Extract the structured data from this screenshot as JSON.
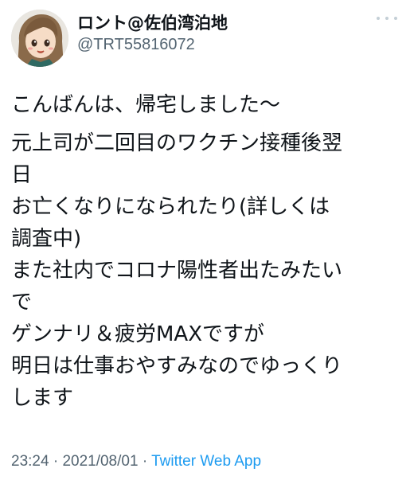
{
  "tweet": {
    "author": {
      "display_name": "ロント@佐伯湾泊地",
      "handle": "@TRT55816072",
      "avatar_icon": "anime-character-avatar-icon"
    },
    "more_icon": "more-options-icon",
    "paragraphs": [
      "こんばんは、帰宅しました〜",
      "元上司が二回目のワクチン接種後翌\n日\nお亡くなりになられたり(詳しくは\n調査中)\nまた社内でコロナ陽性者出たみたい\nで\nゲンナリ＆疲労MAXですが\n明日は仕事おやすみなのでゆっくり\nします"
    ],
    "time": "23:24",
    "separator": "·",
    "date": "2021/08/01",
    "source": "Twitter Web App"
  },
  "colors": {
    "text": "#0f1419",
    "secondary": "#536471",
    "link": "#1d9bf0",
    "background": "#ffffff"
  }
}
